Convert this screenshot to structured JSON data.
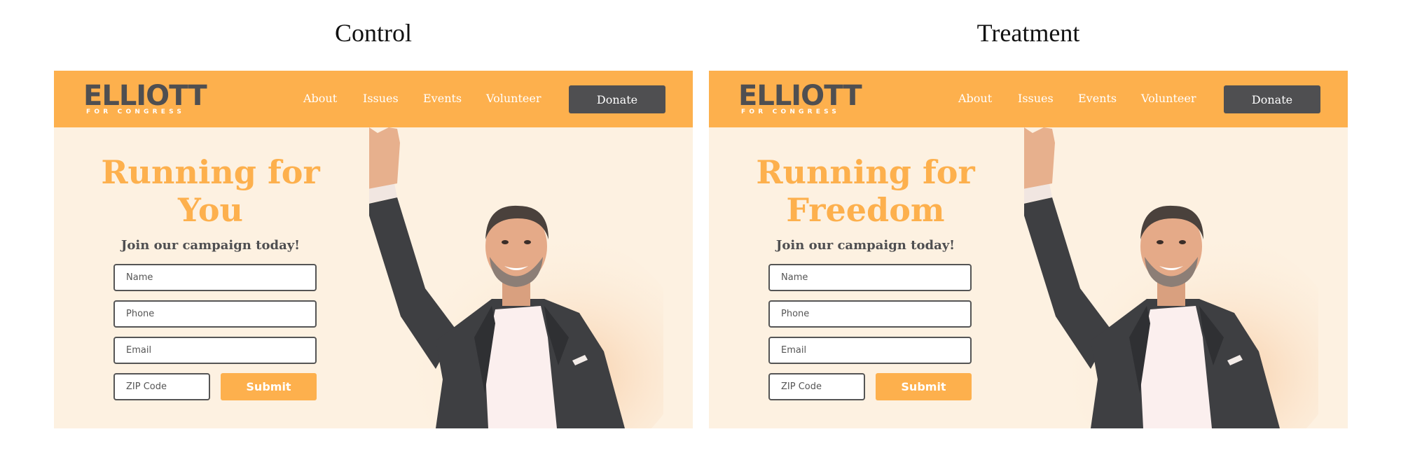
{
  "panels": [
    {
      "label": "Control",
      "header": {
        "logo_main": "ELLIOTT",
        "logo_sub": "FOR CONGRESS",
        "nav": [
          "About",
          "Issues",
          "Events",
          "Volunteer"
        ],
        "donate": "Donate"
      },
      "hero": {
        "headline_line1": "Running for",
        "headline_line2": "You",
        "subhead": "Join our campaign today!"
      },
      "form": {
        "name_placeholder": "Name",
        "phone_placeholder": "Phone",
        "email_placeholder": "Email",
        "zip_placeholder": "ZIP Code",
        "submit": "Submit"
      }
    },
    {
      "label": "Treatment",
      "header": {
        "logo_main": "ELLIOTT",
        "logo_sub": "FOR CONGRESS",
        "nav": [
          "About",
          "Issues",
          "Events",
          "Volunteer"
        ],
        "donate": "Donate"
      },
      "hero": {
        "headline_line1": "Running for",
        "headline_line2": "Freedom",
        "subhead": "Join our campaign today!"
      },
      "form": {
        "name_placeholder": "Name",
        "phone_placeholder": "Phone",
        "email_placeholder": "Email",
        "zip_placeholder": "ZIP Code",
        "submit": "Submit"
      }
    }
  ],
  "colors": {
    "accent": "#fdb04d",
    "dark": "#4f4f51",
    "cream": "#fdf1e1"
  }
}
